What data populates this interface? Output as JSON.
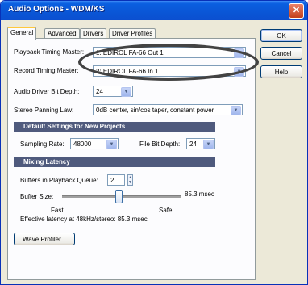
{
  "window": {
    "title": "Audio Options - WDM/KS",
    "close_glyph": "✕"
  },
  "tabs": [
    {
      "label": "General",
      "active": true
    },
    {
      "label": "Advanced",
      "active": false
    },
    {
      "label": "Drivers",
      "active": false
    },
    {
      "label": "Driver Profiles",
      "active": false
    }
  ],
  "general": {
    "playback_label": "Playback Timing Master:",
    "playback_value": "1: EDIROL FA-66 Out 1",
    "record_label": "Record Timing Master:",
    "record_value": "2: EDIROL FA-66 In 1",
    "bit_depth_label": "Audio Driver Bit Depth:",
    "bit_depth_value": "24",
    "panning_label": "Stereo Panning Law:",
    "panning_value": "0dB center, sin/cos taper, constant power"
  },
  "defaults": {
    "header": "Default Settings for New Projects",
    "sampling_label": "Sampling Rate:",
    "sampling_value": "48000",
    "file_bit_label": "File Bit Depth:",
    "file_bit_value": "24"
  },
  "latency": {
    "header": "Mixing Latency",
    "buffers_label": "Buffers in Playback Queue:",
    "buffers_value": "2",
    "buffer_size_label": "Buffer Size:",
    "buffer_size_readout": "85.3 msec",
    "slider_fraction": 0.47,
    "fast_label": "Fast",
    "safe_label": "Safe",
    "effective_text": "Effective latency at 48kHz/stereo:  85.3 msec"
  },
  "buttons": {
    "wave_profiler": "Wave Profiler...",
    "ok": "OK",
    "cancel": "Cancel",
    "help": "Help"
  },
  "icons": {
    "dropdown": "▼",
    "spin_up": "▲",
    "spin_down": "▼"
  },
  "colors": {
    "titlebar": "#0a56d6",
    "group_header": "#4f5a7d",
    "close_button": "#c3411c"
  }
}
